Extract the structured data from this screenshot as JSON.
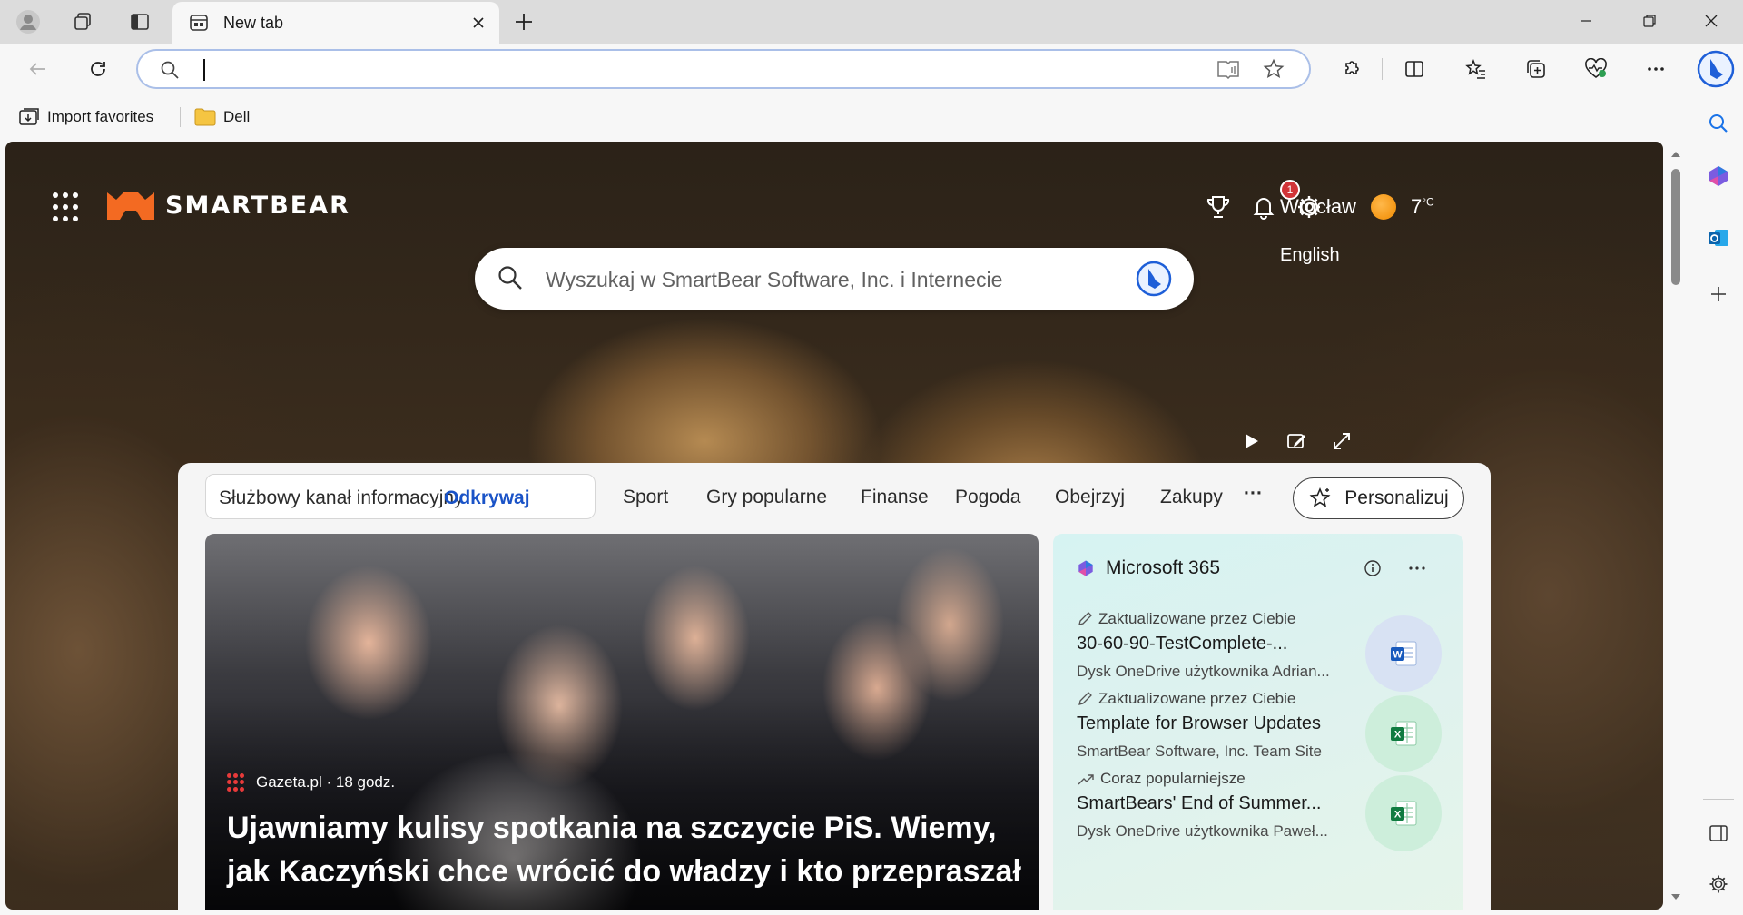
{
  "browser": {
    "tab": {
      "title": "New tab"
    },
    "address_bar": {
      "value": "",
      "placeholder": ""
    },
    "favorites": [
      {
        "label": "Import favorites",
        "icon": "import-favorites-icon"
      },
      {
        "label": "Dell",
        "icon": "folder-icon"
      }
    ]
  },
  "page": {
    "brand": "SMARTBEAR",
    "weather": {
      "city": "Wrocław",
      "temp": "7",
      "unit": "°C",
      "icon": "sun-icon"
    },
    "notifications_count": "1",
    "language": "English",
    "search": {
      "placeholder": "Wyszukaj w SmartBear Software, Inc. i Internecie"
    },
    "nav": {
      "group": [
        "Służbowy kanał informacyjny",
        "Odkrywaj"
      ],
      "active": "Odkrywaj",
      "items": [
        "Sport",
        "Gry popularne",
        "Finanse",
        "Pogoda",
        "Obejrzyj",
        "Zakupy"
      ],
      "more": "···",
      "personalize": "Personalizuj"
    },
    "hero": {
      "source": "Gazeta.pl · 18 godz.",
      "title": "Ujawniamy kulisy spotkania na szczycie PiS. Wiemy, jak Kaczyński chce wrócić do władzy i kto przepraszał"
    },
    "m365": {
      "title": "Microsoft 365",
      "docs": [
        {
          "meta": "Zaktualizowane przez Ciebie",
          "meta_icon": "pencil-icon",
          "title": "30-60-90-TestComplete-...",
          "location": "Dysk OneDrive użytkownika Adrian...",
          "type": "word"
        },
        {
          "meta": "Zaktualizowane przez Ciebie",
          "meta_icon": "pencil-icon",
          "title": "Template for Browser Updates",
          "location": "SmartBear Software, Inc. Team Site",
          "type": "excel"
        },
        {
          "meta": "Coraz popularniejsze",
          "meta_icon": "trending-icon",
          "title": "SmartBears' End of Summer...",
          "location": "Dysk OneDrive użytkownika Paweł...",
          "type": "excel"
        }
      ]
    }
  },
  "colors": {
    "accent": "#1a53c7",
    "brand_orange": "#f36a22",
    "badge": "#d13438"
  }
}
